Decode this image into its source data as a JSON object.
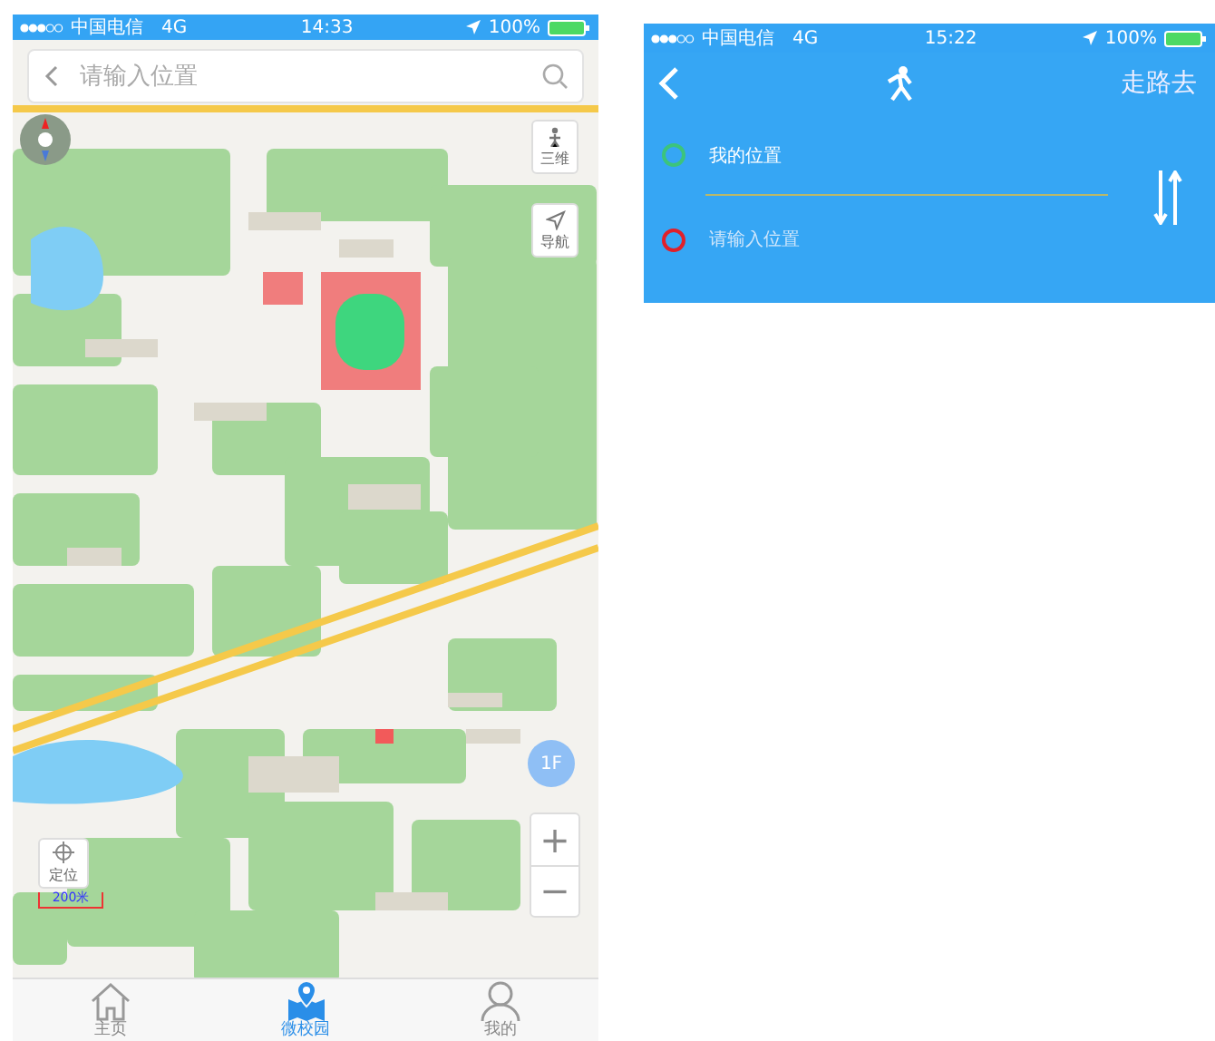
{
  "left_screen": {
    "status_bar": {
      "carrier": "中国电信",
      "network": "4G",
      "time": "14:33",
      "battery": "100%"
    },
    "search": {
      "placeholder": "请输入位置"
    },
    "map_controls": {
      "three_d": "三维",
      "navigate": "导航",
      "locate": "定位",
      "scale": "200米",
      "floor": "1F",
      "zoom_in": "+",
      "zoom_out": "−"
    },
    "tabs": [
      {
        "label": "主页",
        "selected": false,
        "kind": "home"
      },
      {
        "label": "微校园",
        "selected": true,
        "kind": "map"
      },
      {
        "label": "我的",
        "selected": false,
        "kind": "profile"
      }
    ]
  },
  "right_screen": {
    "status_bar": {
      "carrier": "中国电信",
      "network": "4G",
      "time": "15:22",
      "battery": "100%"
    },
    "title": "走路去",
    "from": {
      "value": "我的位置",
      "color": "#3cc47c"
    },
    "to": {
      "placeholder": "请输入位置",
      "color": "#e0202a"
    }
  }
}
